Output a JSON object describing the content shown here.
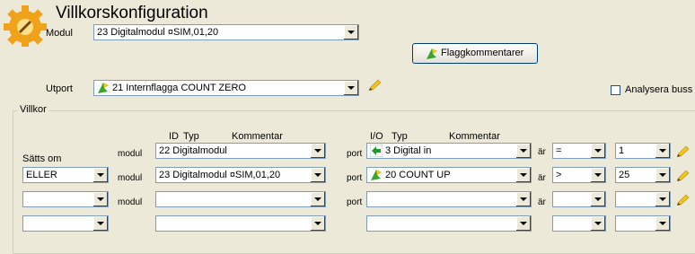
{
  "window": {
    "title": "Villkorskonfiguration"
  },
  "header": {
    "modul_label": "Modul",
    "modul_value": "23 Digitalmodul ¤SIM,01,20",
    "utport_label": "Utport",
    "utport_value": "21 Internflagga COUNT ZERO",
    "flag_button_label": "Flaggkommentarer",
    "analyze_label": "Analysera buss",
    "analyze_checked": false
  },
  "villkor": {
    "group_label": "Villkor",
    "col_headers": {
      "id": "ID",
      "typ": "Typ",
      "kommentar": "Kommentar",
      "io": "I/O",
      "typ2": "Typ",
      "kommentar2": "Kommentar"
    },
    "satts_om_label": "Sätts om",
    "row_modul_label": "modul",
    "row_port_label": "port",
    "row_ar_label": "är",
    "rows": [
      {
        "logic": "",
        "modul": "22 Digitalmodul",
        "port": "3 Digital in",
        "port_icon": "green-arrow-left-icon",
        "op": "=",
        "value": "1"
      },
      {
        "logic": "ELLER",
        "modul": "23 Digitalmodul ¤SIM,01,20",
        "port": "20 COUNT UP",
        "port_icon": "flag-icon",
        "op": ">",
        "value": "25"
      },
      {
        "logic": "",
        "modul": "",
        "port": "",
        "port_icon": "",
        "op": "",
        "value": ""
      },
      {
        "logic": "",
        "modul": "",
        "port": "",
        "port_icon": "",
        "op": "",
        "value": ""
      }
    ]
  },
  "colors": {
    "background": "#ece9d8",
    "border_blue": "#7f9db9",
    "flag_green": "#3aa52e",
    "flag_yellow": "#f2c51b"
  }
}
